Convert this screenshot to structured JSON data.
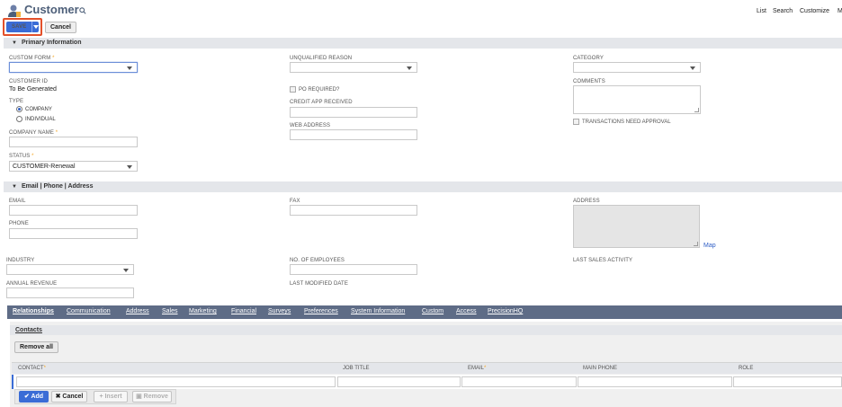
{
  "header": {
    "title": "Customer",
    "links": [
      "List",
      "Search",
      "Customize",
      "M"
    ]
  },
  "toolbar": {
    "save_label": "Save",
    "cancel_label": "Cancel"
  },
  "primary": {
    "section_title": "Primary Information",
    "custom_form_label": "CUSTOM FORM",
    "customer_id_label": "CUSTOMER ID",
    "customer_id_value": "To Be Generated",
    "type_label": "TYPE",
    "type_options": [
      "COMPANY",
      "INDIVIDUAL"
    ],
    "type_selected": "COMPANY",
    "company_name_label": "COMPANY NAME",
    "status_label": "STATUS",
    "status_value": "CUSTOMER-Renewal",
    "unqualified_reason_label": "UNQUALIFIED REASON",
    "po_required_label": "PO REQUIRED?",
    "credit_app_label": "CREDIT APP RECEIVED",
    "web_address_label": "WEB ADDRESS",
    "category_label": "CATEGORY",
    "comments_label": "COMMENTS",
    "transactions_approval_label": "TRANSACTIONS NEED APPROVAL",
    "required_mark": "*"
  },
  "contact": {
    "section_title": "Email | Phone | Address",
    "email_label": "EMAIL",
    "phone_label": "PHONE",
    "fax_label": "FAX",
    "address_label": "ADDRESS",
    "map_label": "Map"
  },
  "misc": {
    "industry_label": "INDUSTRY",
    "annual_revenue_label": "ANNUAL REVENUE",
    "employees_label": "NO. OF EMPLOYEES",
    "last_modified_label": "LAST MODIFIED DATE",
    "last_sales_label": "LAST SALES ACTIVITY"
  },
  "tabs": [
    "Relationships",
    "Communication",
    "Address",
    "Sales",
    "Marketing",
    "Financial",
    "Surveys",
    "Preferences",
    "System Information",
    "Custom",
    "Access",
    "PrecisionHQ"
  ],
  "contacts": {
    "title": "Contacts",
    "remove_all": "Remove all",
    "columns": [
      "CONTACT",
      "JOB TITLE",
      "EMAIL",
      "MAIN PHONE",
      "ROLE"
    ],
    "add": "Add",
    "cancel": "Cancel",
    "insert": "Insert",
    "remove": "Remove"
  },
  "colors": {
    "accent": "#3a6cd6",
    "highlight": "#e3502a",
    "tabbar": "#5e6c86"
  }
}
